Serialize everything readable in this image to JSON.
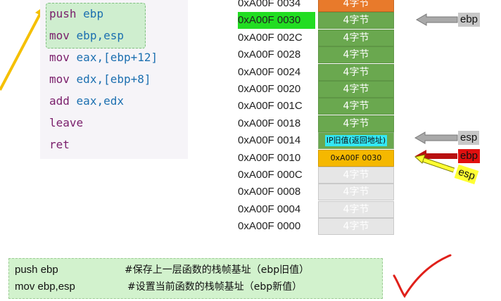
{
  "code": {
    "lines": [
      {
        "op": "push",
        "args": "ebp"
      },
      {
        "op": "mov",
        "args": "ebp,esp"
      },
      {
        "op": "mov",
        "args": "eax,[ebp+12]"
      },
      {
        "op": "mov",
        "args": "edx,[ebp+8]"
      },
      {
        "op": "add",
        "args": "eax,edx"
      },
      {
        "op": "leave",
        "args": ""
      },
      {
        "op": "ret",
        "args": ""
      }
    ]
  },
  "stack": {
    "rows": [
      {
        "addr": "0xA00F 0034",
        "value": "4字节",
        "style": "orange"
      },
      {
        "addr": "0xA00F 0030",
        "value": "4字节",
        "style": "green",
        "addr_highlight": true
      },
      {
        "addr": "0xA00F 002C",
        "value": "4字节",
        "style": "green"
      },
      {
        "addr": "0xA00F 0028",
        "value": "4字节",
        "style": "green"
      },
      {
        "addr": "0xA00F 0024",
        "value": "4字节",
        "style": "green"
      },
      {
        "addr": "0xA00F 0020",
        "value": "4字节",
        "style": "green"
      },
      {
        "addr": "0xA00F 001C",
        "value": "4字节",
        "style": "green"
      },
      {
        "addr": "0xA00F 0018",
        "value": "4字节",
        "style": "green"
      },
      {
        "addr": "0xA00F 0014",
        "value": "IP旧值(返回地址)",
        "style": "ret"
      },
      {
        "addr": "0xA00F 0010",
        "value": "0xA00F 0030",
        "style": "saved"
      },
      {
        "addr": "0xA00F 000C",
        "value": "4字节",
        "style": "empty"
      },
      {
        "addr": "0xA00F 0008",
        "value": "4字节",
        "style": "empty"
      },
      {
        "addr": "0xA00F 0004",
        "value": "4字节",
        "style": "empty"
      },
      {
        "addr": "0xA00F 0000",
        "value": "4字节",
        "style": "empty"
      }
    ]
  },
  "pointers": {
    "ebp_old": "ebp",
    "esp_gray": "esp",
    "ebp_red": "ebp",
    "esp_yellow": "esp"
  },
  "notes": {
    "line1_code": "push ebp",
    "line1_comment": "#保存上一层函数的栈帧基址（ebp旧值）",
    "line2_code": "mov ebp,esp",
    "line2_comment": "#设置当前函数的栈帧基址（ebp新值）"
  },
  "colors": {
    "stack_green": "#6aa84f",
    "stack_orange": "#e87a2b",
    "stack_empty": "#e6e6e6",
    "saved_ebp": "#f5b800",
    "ret_tag": "#33e8f5",
    "addr_highlight": "#22dd22",
    "pointer_red": "#e01010",
    "pointer_yellow": "#ffff33",
    "checkmark": "#e0201a"
  }
}
